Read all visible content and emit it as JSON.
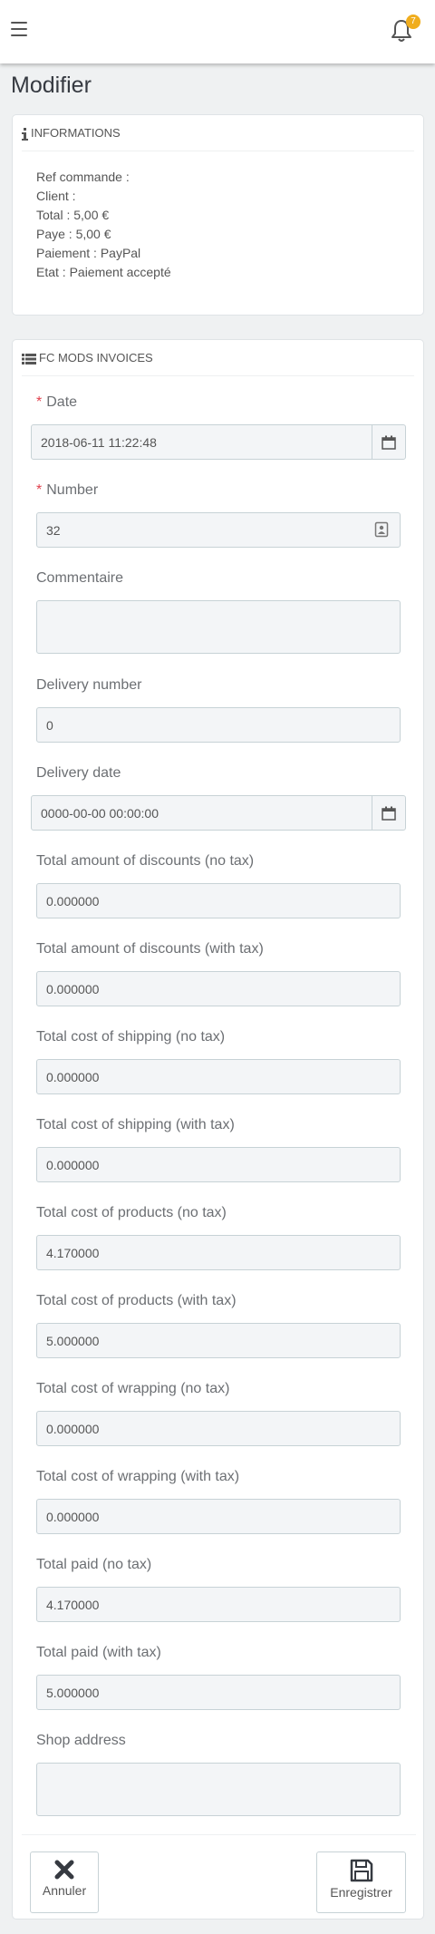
{
  "header": {
    "notification_count": "7"
  },
  "page": {
    "title": "Modifier"
  },
  "info_panel": {
    "heading": "INFORMATIONS",
    "lines": [
      "Ref commande :",
      "Client :",
      "Total : 5,00 €",
      "Paye : 5,00 €",
      "Paiement : PayPal",
      "Etat : Paiement accepté"
    ]
  },
  "form_panel": {
    "heading": "FC MODS INVOICES",
    "fields": [
      {
        "label": "Date",
        "required": true,
        "value": "2018-06-11 11:22:48"
      },
      {
        "label": "Number",
        "required": true,
        "value": "32"
      },
      {
        "label": "Commentaire",
        "required": false,
        "value": ""
      },
      {
        "label": "Delivery number",
        "required": false,
        "value": "0"
      },
      {
        "label": "Delivery date",
        "required": false,
        "value": "0000-00-00 00:00:00"
      },
      {
        "label": "Total amount of discounts (no tax)",
        "required": false,
        "value": "0.000000"
      },
      {
        "label": "Total amount of discounts (with tax)",
        "required": false,
        "value": "0.000000"
      },
      {
        "label": "Total cost of shipping (no tax)",
        "required": false,
        "value": "0.000000"
      },
      {
        "label": "Total cost of shipping (with tax)",
        "required": false,
        "value": "0.000000"
      },
      {
        "label": "Total cost of products (no tax)",
        "required": false,
        "value": "4.170000"
      },
      {
        "label": "Total cost of products (with tax)",
        "required": false,
        "value": "5.000000"
      },
      {
        "label": "Total cost of wrapping (no tax)",
        "required": false,
        "value": "0.000000"
      },
      {
        "label": "Total cost of wrapping (with tax)",
        "required": false,
        "value": "0.000000"
      },
      {
        "label": "Total paid (no tax)",
        "required": false,
        "value": "4.170000"
      },
      {
        "label": "Total paid (with tax)",
        "required": false,
        "value": "5.000000"
      },
      {
        "label": "Shop address",
        "required": false,
        "value": ""
      }
    ],
    "required_marker": "*",
    "cancel_label": "Annuler",
    "save_label": "Enregistrer"
  }
}
